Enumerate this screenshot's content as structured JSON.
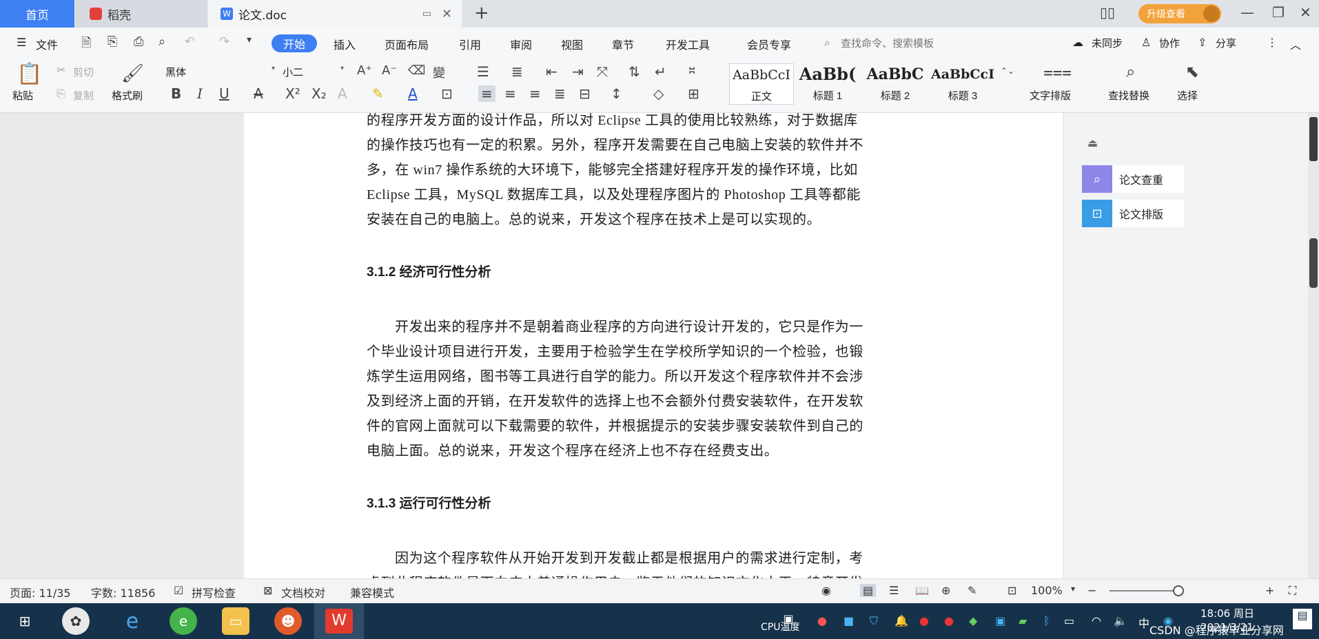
{
  "tabs": {
    "home": "首页",
    "daoke": "稻壳",
    "doc": "论文.doc",
    "upgrade": "升级查看"
  },
  "menu": {
    "file": "文件",
    "start": "开始",
    "insert": "插入",
    "layout": "页面布局",
    "reference": "引用",
    "review": "审阅",
    "view": "视图",
    "chapter": "章节",
    "dev": "开发工具",
    "member": "会员专享",
    "search": "查找命令、搜索模板",
    "unsynced": "未同步",
    "collab": "协作",
    "share": "分享"
  },
  "ribbon": {
    "paste": "粘贴",
    "cut": "剪切",
    "copy": "复制",
    "format_painter": "格式刷",
    "font": "黑体",
    "font_size": "小二",
    "styles": [
      {
        "preview": "AaBbCcI",
        "name": "正文"
      },
      {
        "preview": "AaBb(",
        "name": "标题 1"
      },
      {
        "preview": "AaBbC",
        "name": "标题 2"
      },
      {
        "preview": "AaBbCcI",
        "name": "标题 3"
      }
    ],
    "text_layout": "文字排版",
    "find_replace": "查找替换",
    "select": "选择"
  },
  "document": {
    "lines": [
      {
        "text": "的程序开发方面的设计作品，所以对 Eclipse 工具的使用比较熟练，对于数据库",
        "kind": "body"
      },
      {
        "text": "的操作技巧也有一定的积累。另外，程序开发需要在自己电脑上安装的软件并不",
        "kind": "body"
      },
      {
        "text": "多，在 win7 操作系统的大环境下，能够完全搭建好程序开发的操作环境，比如",
        "kind": "body"
      },
      {
        "text": "Eclipse 工具，MySQL 数据库工具，以及处理程序图片的 Photoshop 工具等都能",
        "kind": "body"
      },
      {
        "text": "安装在自己的电脑上。总的说来，开发这个程序在技术上是可以实现的。",
        "kind": "body"
      },
      {
        "text": "3.1.2  经济可行性分析",
        "kind": "heading"
      },
      {
        "text": "开发出来的程序并不是朝着商业程序的方向进行设计开发的，它只是作为一",
        "kind": "indent"
      },
      {
        "text": "个毕业设计项目进行开发，主要用于检验学生在学校所学知识的一个检验，也锻",
        "kind": "body"
      },
      {
        "text": "炼学生运用网络，图书等工具进行自学的能力。所以开发这个程序软件并不会涉",
        "kind": "body"
      },
      {
        "text": "及到经济上面的开销，在开发软件的选择上也不会额外付费安装软件，在开发软",
        "kind": "body"
      },
      {
        "text": "件的官网上面就可以下载需要的软件，并根据提示的安装步骤安装软件到自己的",
        "kind": "body"
      },
      {
        "text": "电脑上面。总的说来，开发这个程序在经济上也不存在经费支出。",
        "kind": "body"
      },
      {
        "text": "3.1.3  运行可行性分析",
        "kind": "heading"
      },
      {
        "text": "因为这个程序软件从开始开发到开发截止都是根据用户的需求进行定制，考",
        "kind": "indent"
      },
      {
        "text": "虑到此程序软件是面向广大普通操作用户，鉴于他们的知识文化水平，特意开发",
        "kind": "body"
      }
    ]
  },
  "panel": {
    "check": "论文查重",
    "typeset": "论文排版"
  },
  "status": {
    "page": "页面: 11/35",
    "words": "字数: 11856",
    "spell": "拼写检查",
    "proof": "文档校对",
    "compat": "兼容模式",
    "zoom": "100%"
  },
  "taskbar": {
    "time": "18:06 周日",
    "date": "2021/3/21",
    "cpu": "CPU温度",
    "watermark": "CSDN @程序猿毕业分享网"
  }
}
